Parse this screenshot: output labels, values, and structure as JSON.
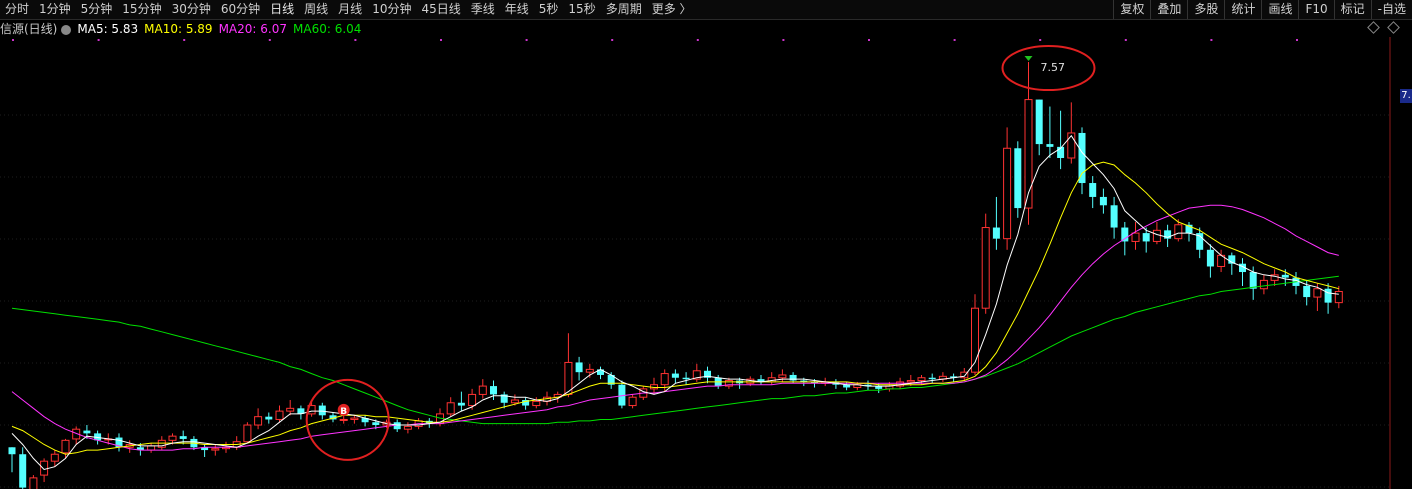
{
  "toolbar": {
    "items": [
      "分时",
      "1分钟",
      "5分钟",
      "15分钟",
      "30分钟",
      "60分钟",
      "日线",
      "周线",
      "月线",
      "10分钟",
      "45日线",
      "季线",
      "年线",
      "5秒",
      "15秒",
      "多周期",
      "更多 〉"
    ],
    "right_buttons": [
      "复权",
      "叠加",
      "多股",
      "统计",
      "画线",
      "F10",
      "标记",
      "-自选"
    ]
  },
  "legend": {
    "stock_name": "信源(日线)",
    "ma5": "MA5: 5.83",
    "ma10": "MA10: 5.89",
    "ma20": "MA20: 6.07",
    "ma60": "MA60: 6.04"
  },
  "right_price_tag": "7.",
  "chart_data": {
    "type": "candlestick",
    "ylim": [
      4.5,
      7.75
    ],
    "high_label": "7.57",
    "buy_marker": "B",
    "colors": {
      "up": "#ff3232",
      "down": "#54ffff",
      "ma5": "#ffffff",
      "ma10": "#ffff00",
      "ma20": "#ff33ff",
      "ma60": "#00e000",
      "annotation": "#e02020"
    },
    "candles": [
      [
        4.8,
        4.75,
        4.8,
        4.62
      ],
      [
        4.75,
        4.51,
        4.8,
        4.5
      ],
      [
        4.48,
        4.58,
        4.6,
        4.45
      ],
      [
        4.6,
        4.7,
        4.72,
        4.55
      ],
      [
        4.7,
        4.75,
        4.78,
        4.66
      ],
      [
        4.76,
        4.85,
        4.86,
        4.72
      ],
      [
        4.86,
        4.93,
        4.95,
        4.82
      ],
      [
        4.92,
        4.9,
        4.96,
        4.86
      ],
      [
        4.9,
        4.85,
        4.92,
        4.82
      ],
      [
        4.86,
        4.86,
        4.9,
        4.82
      ],
      [
        4.87,
        4.8,
        4.9,
        4.77
      ],
      [
        4.8,
        4.82,
        4.85,
        4.76
      ],
      [
        4.8,
        4.78,
        4.83,
        4.74
      ],
      [
        4.78,
        4.81,
        4.83,
        4.76
      ],
      [
        4.8,
        4.85,
        4.88,
        4.78
      ],
      [
        4.85,
        4.88,
        4.9,
        4.82
      ],
      [
        4.88,
        4.86,
        4.92,
        4.82
      ],
      [
        4.86,
        4.8,
        4.88,
        4.78
      ],
      [
        4.8,
        4.78,
        4.82,
        4.73
      ],
      [
        4.78,
        4.79,
        4.82,
        4.74
      ],
      [
        4.79,
        4.8,
        4.84,
        4.76
      ],
      [
        4.8,
        4.84,
        4.88,
        4.78
      ],
      [
        4.84,
        4.96,
        4.98,
        4.83
      ],
      [
        4.96,
        5.02,
        5.08,
        4.93
      ],
      [
        5.02,
        5.0,
        5.05,
        4.97
      ],
      [
        5.0,
        5.06,
        5.1,
        4.98
      ],
      [
        5.06,
        5.08,
        5.14,
        5.03
      ],
      [
        5.08,
        5.04,
        5.1,
        5.0
      ],
      [
        5.04,
        5.1,
        5.14,
        5.02
      ],
      [
        5.1,
        5.03,
        5.12,
        5.0
      ],
      [
        5.03,
        5.0,
        5.05,
        4.98
      ],
      [
        5.0,
        5.0,
        5.04,
        4.97
      ],
      [
        5.0,
        5.01,
        5.03,
        4.97
      ],
      [
        5.01,
        4.98,
        5.03,
        4.95
      ],
      [
        4.98,
        4.96,
        5.0,
        4.93
      ],
      [
        4.96,
        4.98,
        5.0,
        4.94
      ],
      [
        4.98,
        4.93,
        5.0,
        4.91
      ],
      [
        4.93,
        4.95,
        4.98,
        4.9
      ],
      [
        4.95,
        4.99,
        5.01,
        4.93
      ],
      [
        4.99,
        4.97,
        5.01,
        4.94
      ],
      [
        4.97,
        5.04,
        5.08,
        4.95
      ],
      [
        5.04,
        5.12,
        5.16,
        5.02
      ],
      [
        5.12,
        5.1,
        5.2,
        5.06
      ],
      [
        5.1,
        5.18,
        5.22,
        5.07
      ],
      [
        5.18,
        5.24,
        5.29,
        5.15
      ],
      [
        5.24,
        5.18,
        5.28,
        5.14
      ],
      [
        5.18,
        5.12,
        5.2,
        5.08
      ],
      [
        5.12,
        5.14,
        5.18,
        5.1
      ],
      [
        5.14,
        5.1,
        5.16,
        5.07
      ],
      [
        5.1,
        5.13,
        5.16,
        5.08
      ],
      [
        5.13,
        5.16,
        5.2,
        5.1
      ],
      [
        5.16,
        5.18,
        5.2,
        5.12
      ],
      [
        5.18,
        5.41,
        5.62,
        5.16
      ],
      [
        5.41,
        5.34,
        5.45,
        5.28
      ],
      [
        5.34,
        5.36,
        5.4,
        5.3
      ],
      [
        5.36,
        5.32,
        5.38,
        5.29
      ],
      [
        5.32,
        5.25,
        5.34,
        5.22
      ],
      [
        5.25,
        5.1,
        5.28,
        5.08
      ],
      [
        5.1,
        5.16,
        5.18,
        5.08
      ],
      [
        5.16,
        5.22,
        5.24,
        5.14
      ],
      [
        5.22,
        5.25,
        5.3,
        5.18
      ],
      [
        5.25,
        5.33,
        5.36,
        5.2
      ],
      [
        5.33,
        5.3,
        5.36,
        5.26
      ],
      [
        5.3,
        5.29,
        5.34,
        5.25
      ],
      [
        5.29,
        5.35,
        5.4,
        5.27
      ],
      [
        5.35,
        5.3,
        5.38,
        5.26
      ],
      [
        5.3,
        5.24,
        5.32,
        5.22
      ],
      [
        5.24,
        5.28,
        5.3,
        5.22
      ],
      [
        5.28,
        5.26,
        5.3,
        5.22
      ],
      [
        5.26,
        5.29,
        5.31,
        5.24
      ],
      [
        5.29,
        5.27,
        5.32,
        5.25
      ],
      [
        5.27,
        5.3,
        5.34,
        5.25
      ],
      [
        5.3,
        5.32,
        5.36,
        5.27
      ],
      [
        5.32,
        5.28,
        5.34,
        5.26
      ],
      [
        5.28,
        5.27,
        5.3,
        5.24
      ],
      [
        5.27,
        5.26,
        5.29,
        5.23
      ],
      [
        5.26,
        5.27,
        5.3,
        5.24
      ],
      [
        5.27,
        5.25,
        5.29,
        5.22
      ],
      [
        5.25,
        5.23,
        5.27,
        5.21
      ],
      [
        5.23,
        5.25,
        5.27,
        5.21
      ],
      [
        5.25,
        5.24,
        5.28,
        5.21
      ],
      [
        5.24,
        5.22,
        5.26,
        5.19
      ],
      [
        5.22,
        5.24,
        5.27,
        5.2
      ],
      [
        5.24,
        5.27,
        5.3,
        5.22
      ],
      [
        5.27,
        5.28,
        5.32,
        5.24
      ],
      [
        5.28,
        5.3,
        5.32,
        5.25
      ],
      [
        5.3,
        5.29,
        5.33,
        5.26
      ],
      [
        5.29,
        5.31,
        5.34,
        5.27
      ],
      [
        5.31,
        5.3,
        5.33,
        5.27
      ],
      [
        5.3,
        5.34,
        5.37,
        5.28
      ],
      [
        5.34,
        5.8,
        5.9,
        5.32
      ],
      [
        5.8,
        6.38,
        6.48,
        5.76
      ],
      [
        6.38,
        6.3,
        6.6,
        6.22
      ],
      [
        6.3,
        6.95,
        7.1,
        6.22
      ],
      [
        6.95,
        6.52,
        7.0,
        6.45
      ],
      [
        6.52,
        7.3,
        7.57,
        6.4
      ],
      [
        7.3,
        6.98,
        7.3,
        6.9
      ],
      [
        6.98,
        6.96,
        7.25,
        6.88
      ],
      [
        6.96,
        6.88,
        7.22,
        6.8
      ],
      [
        6.88,
        7.06,
        7.28,
        6.84
      ],
      [
        7.06,
        6.7,
        7.1,
        6.62
      ],
      [
        6.7,
        6.6,
        6.75,
        6.52
      ],
      [
        6.6,
        6.54,
        6.66,
        6.48
      ],
      [
        6.54,
        6.38,
        6.6,
        6.3
      ],
      [
        6.38,
        6.28,
        6.42,
        6.18
      ],
      [
        6.28,
        6.34,
        6.42,
        6.22
      ],
      [
        6.34,
        6.28,
        6.38,
        6.2
      ],
      [
        6.28,
        6.36,
        6.42,
        6.26
      ],
      [
        6.36,
        6.3,
        6.4,
        6.24
      ],
      [
        6.3,
        6.4,
        6.44,
        6.28
      ],
      [
        6.4,
        6.34,
        6.42,
        6.28
      ],
      [
        6.34,
        6.22,
        6.38,
        6.16
      ],
      [
        6.22,
        6.1,
        6.26,
        6.02
      ],
      [
        6.1,
        6.18,
        6.22,
        6.06
      ],
      [
        6.18,
        6.12,
        6.2,
        6.04
      ],
      [
        6.12,
        6.06,
        6.16,
        5.96
      ],
      [
        6.06,
        5.94,
        6.1,
        5.86
      ],
      [
        5.94,
        6.0,
        6.04,
        5.9
      ],
      [
        6.0,
        6.04,
        6.08,
        5.96
      ],
      [
        6.04,
        6.02,
        6.08,
        5.96
      ],
      [
        6.02,
        5.96,
        6.06,
        5.9
      ],
      [
        5.96,
        5.88,
        6.0,
        5.82
      ],
      [
        5.88,
        5.94,
        5.98,
        5.78
      ],
      [
        5.94,
        5.84,
        5.98,
        5.76
      ],
      [
        5.84,
        5.92,
        5.96,
        5.8
      ]
    ],
    "ma5": [
      4.9,
      4.82,
      4.72,
      4.64,
      4.66,
      4.72,
      4.82,
      4.88,
      4.87,
      4.86,
      4.85,
      4.83,
      4.81,
      4.81,
      4.81,
      4.83,
      4.84,
      4.84,
      4.83,
      4.82,
      4.81,
      4.8,
      4.83,
      4.88,
      4.92,
      4.98,
      5.04,
      5.04,
      5.06,
      5.06,
      5.05,
      5.04,
      5.03,
      5.01,
      4.99,
      4.97,
      4.96,
      4.96,
      4.96,
      4.97,
      4.98,
      5.02,
      5.06,
      5.09,
      5.14,
      5.17,
      5.17,
      5.16,
      5.16,
      5.14,
      5.13,
      5.15,
      5.2,
      5.26,
      5.32,
      5.36,
      5.32,
      5.27,
      5.24,
      5.2,
      5.18,
      5.2,
      5.26,
      5.28,
      5.3,
      5.31,
      5.3,
      5.29,
      5.29,
      5.28,
      5.27,
      5.28,
      5.29,
      5.29,
      5.29,
      5.28,
      5.27,
      5.26,
      5.25,
      5.25,
      5.24,
      5.24,
      5.24,
      5.25,
      5.26,
      5.27,
      5.28,
      5.29,
      5.3,
      5.31,
      5.41,
      5.61,
      5.83,
      6.11,
      6.33,
      6.63,
      6.82,
      6.9,
      6.95,
      7.04,
      6.92,
      6.84,
      6.76,
      6.66,
      6.5,
      6.43,
      6.36,
      6.33,
      6.31,
      6.34,
      6.34,
      6.32,
      6.25,
      6.18,
      6.13,
      6.1,
      6.06,
      6.04,
      6.03,
      6.01,
      6.0,
      5.97,
      5.95,
      5.91,
      5.9
    ],
    "ma10": [
      4.95,
      4.92,
      4.87,
      4.82,
      4.78,
      4.75,
      4.76,
      4.78,
      4.78,
      4.79,
      4.8,
      4.81,
      4.82,
      4.83,
      4.83,
      4.83,
      4.83,
      4.83,
      4.82,
      4.82,
      4.82,
      4.82,
      4.83,
      4.85,
      4.87,
      4.89,
      4.92,
      4.94,
      4.97,
      4.99,
      5.01,
      5.03,
      5.03,
      5.03,
      5.02,
      5.02,
      5.01,
      5.0,
      4.99,
      4.98,
      4.98,
      4.99,
      5.01,
      5.03,
      5.05,
      5.07,
      5.09,
      5.11,
      5.13,
      5.14,
      5.15,
      5.16,
      5.18,
      5.21,
      5.24,
      5.26,
      5.26,
      5.26,
      5.25,
      5.24,
      5.23,
      5.23,
      5.24,
      5.25,
      5.26,
      5.27,
      5.27,
      5.27,
      5.27,
      5.27,
      5.27,
      5.27,
      5.27,
      5.27,
      5.27,
      5.27,
      5.27,
      5.27,
      5.27,
      5.26,
      5.26,
      5.25,
      5.25,
      5.25,
      5.25,
      5.25,
      5.26,
      5.26,
      5.27,
      5.28,
      5.31,
      5.38,
      5.48,
      5.62,
      5.76,
      5.92,
      6.08,
      6.26,
      6.45,
      6.63,
      6.77,
      6.83,
      6.85,
      6.83,
      6.76,
      6.7,
      6.63,
      6.55,
      6.48,
      6.42,
      6.39,
      6.36,
      6.31,
      6.26,
      6.23,
      6.2,
      6.16,
      6.12,
      6.09,
      6.06,
      6.02,
      6.0,
      5.98,
      5.96,
      5.94
    ],
    "ma20": [
      5.2,
      5.14,
      5.08,
      5.02,
      4.97,
      4.93,
      4.9,
      4.87,
      4.85,
      4.83,
      4.81,
      4.79,
      4.78,
      4.78,
      4.78,
      4.78,
      4.79,
      4.79,
      4.8,
      4.8,
      4.8,
      4.8,
      4.81,
      4.82,
      4.83,
      4.84,
      4.85,
      4.86,
      4.88,
      4.89,
      4.9,
      4.91,
      4.92,
      4.93,
      4.94,
      4.95,
      4.96,
      4.96,
      4.97,
      4.97,
      4.97,
      4.98,
      4.99,
      5.0,
      5.01,
      5.02,
      5.03,
      5.04,
      5.05,
      5.06,
      5.07,
      5.09,
      5.1,
      5.12,
      5.14,
      5.15,
      5.16,
      5.17,
      5.18,
      5.19,
      5.19,
      5.2,
      5.21,
      5.22,
      5.23,
      5.24,
      5.24,
      5.25,
      5.25,
      5.25,
      5.25,
      5.25,
      5.26,
      5.26,
      5.26,
      5.26,
      5.26,
      5.26,
      5.26,
      5.26,
      5.26,
      5.26,
      5.26,
      5.26,
      5.26,
      5.26,
      5.26,
      5.26,
      5.26,
      5.27,
      5.29,
      5.32,
      5.37,
      5.43,
      5.5,
      5.58,
      5.66,
      5.75,
      5.85,
      5.95,
      6.04,
      6.12,
      6.19,
      6.25,
      6.3,
      6.35,
      6.39,
      6.43,
      6.46,
      6.49,
      6.52,
      6.53,
      6.54,
      6.54,
      6.53,
      6.51,
      6.48,
      6.45,
      6.41,
      6.37,
      6.32,
      6.28,
      6.24,
      6.2,
      6.18
    ],
    "ma60": [
      5.8,
      5.79,
      5.78,
      5.77,
      5.76,
      5.75,
      5.74,
      5.73,
      5.72,
      5.71,
      5.7,
      5.68,
      5.67,
      5.65,
      5.63,
      5.61,
      5.59,
      5.57,
      5.55,
      5.53,
      5.51,
      5.49,
      5.47,
      5.45,
      5.43,
      5.41,
      5.38,
      5.36,
      5.33,
      5.3,
      5.28,
      5.25,
      5.22,
      5.19,
      5.16,
      5.13,
      5.1,
      5.07,
      5.05,
      5.03,
      5.01,
      5.0,
      4.99,
      4.98,
      4.97,
      4.97,
      4.97,
      4.97,
      4.97,
      4.97,
      4.97,
      4.98,
      4.98,
      4.99,
      4.99,
      5.0,
      5.0,
      5.01,
      5.02,
      5.03,
      5.04,
      5.05,
      5.06,
      5.07,
      5.08,
      5.09,
      5.1,
      5.11,
      5.12,
      5.13,
      5.14,
      5.15,
      5.15,
      5.16,
      5.17,
      5.17,
      5.18,
      5.19,
      5.19,
      5.2,
      5.21,
      5.21,
      5.22,
      5.22,
      5.23,
      5.23,
      5.24,
      5.25,
      5.26,
      5.27,
      5.29,
      5.31,
      5.34,
      5.37,
      5.4,
      5.44,
      5.48,
      5.52,
      5.56,
      5.6,
      5.63,
      5.66,
      5.69,
      5.72,
      5.74,
      5.77,
      5.79,
      5.81,
      5.83,
      5.85,
      5.87,
      5.89,
      5.9,
      5.92,
      5.93,
      5.94,
      5.95,
      5.96,
      5.97,
      5.98,
      5.99,
      6.0,
      6.01,
      6.02,
      6.03
    ]
  }
}
